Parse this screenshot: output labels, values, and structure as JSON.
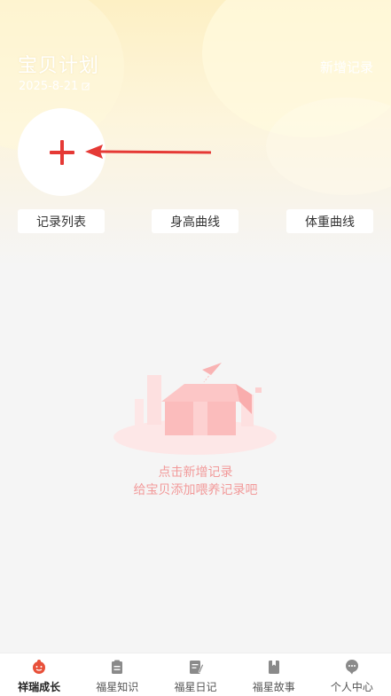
{
  "header": {
    "title": "宝贝计划",
    "date": "2025-8-21",
    "new_record_label": "新增记录"
  },
  "segments": [
    {
      "label": "记录列表"
    },
    {
      "label": "身高曲线"
    },
    {
      "label": "体重曲线"
    }
  ],
  "empty_state": {
    "line1": "点击新增记录",
    "line2": "给宝贝添加喂养记录吧"
  },
  "tabbar": {
    "active_index": 0,
    "items": [
      {
        "label": "祥瑞成长",
        "icon": "baby-face-icon"
      },
      {
        "label": "福星知识",
        "icon": "clipboard-icon"
      },
      {
        "label": "福星日记",
        "icon": "notebook-pen-icon"
      },
      {
        "label": "福星故事",
        "icon": "book-icon"
      },
      {
        "label": "个人中心",
        "icon": "user-chat-icon"
      }
    ]
  },
  "colors": {
    "accent": "#e53935",
    "empty_text": "#f29a9a",
    "hero_top": "#fdf0c4",
    "background": "#f5f5f5"
  }
}
